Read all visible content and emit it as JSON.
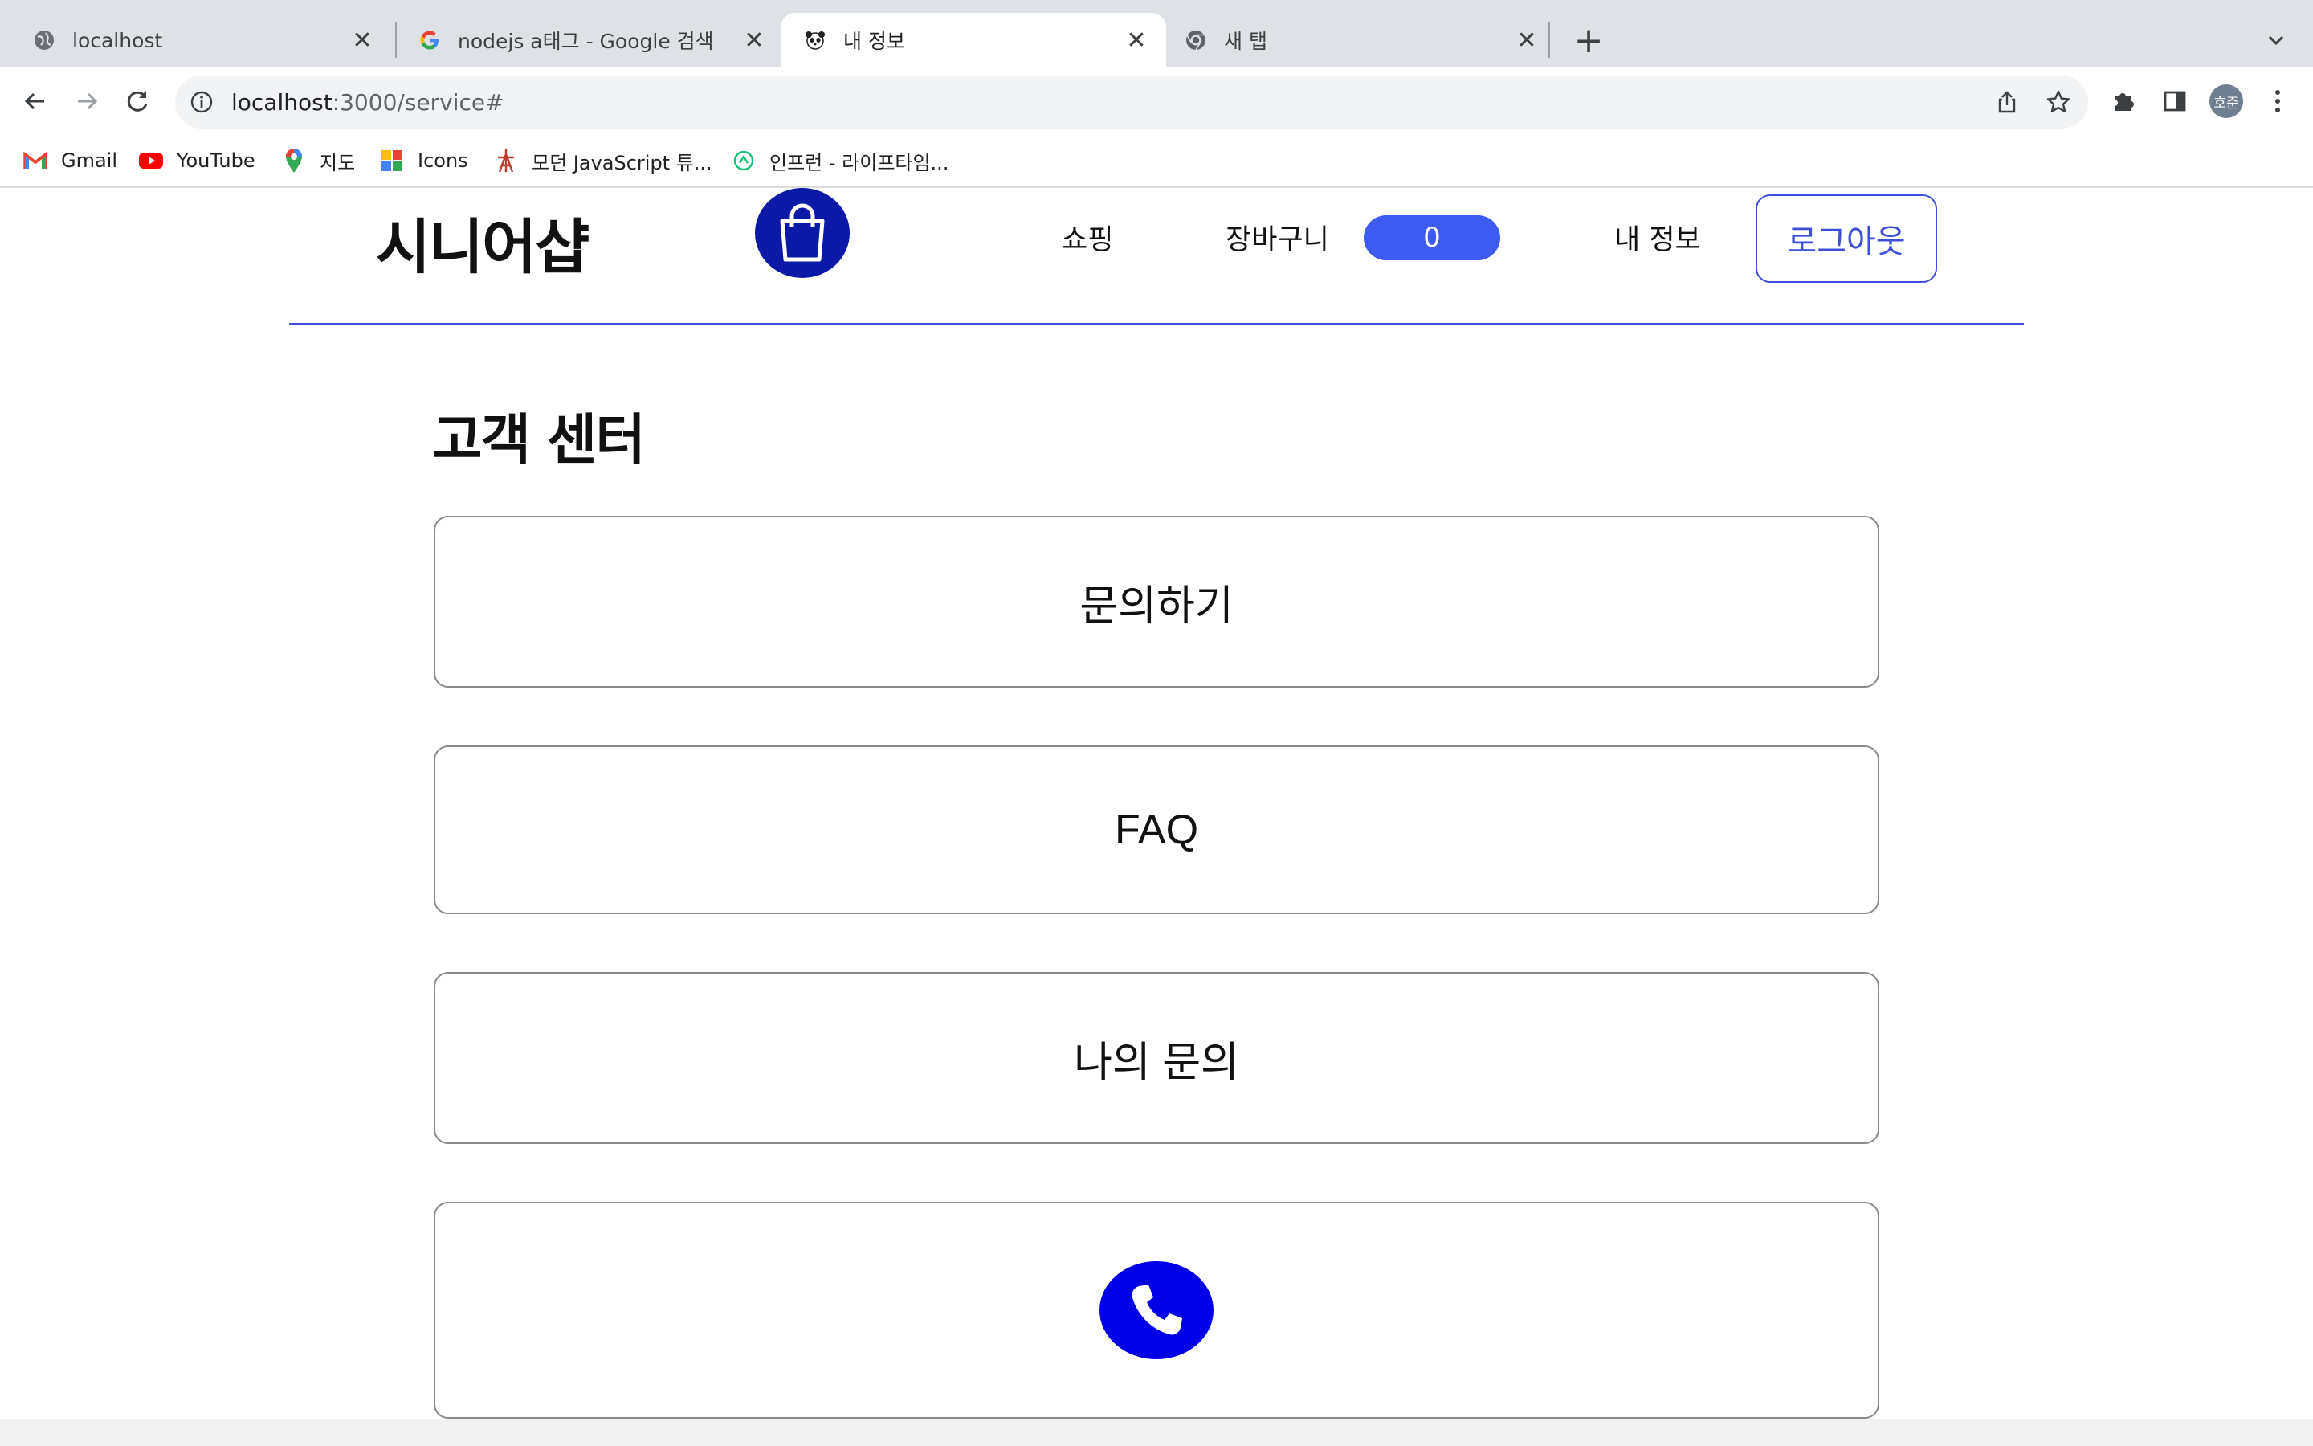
{
  "browser": {
    "tabs": [
      {
        "title": "localhost",
        "icon": "globe-icon",
        "active": false
      },
      {
        "title": "nodejs a태그 - Google 검색",
        "icon": "google-icon",
        "active": false
      },
      {
        "title": "내 정보",
        "icon": "panda-icon",
        "active": true
      },
      {
        "title": "새 탭",
        "icon": "chrome-icon",
        "active": false
      }
    ],
    "close_glyph": "✕",
    "new_tab_glyph": "+",
    "url_host": "localhost",
    "url_rest": ":3000/service#",
    "profile_initials": "호준",
    "bookmarks": [
      {
        "label": "Gmail",
        "icon": "gmail-icon"
      },
      {
        "label": "YouTube",
        "icon": "youtube-icon"
      },
      {
        "label": "지도",
        "icon": "maps-icon"
      },
      {
        "label": "Icons",
        "icon": "icons-icon"
      },
      {
        "label": "모던 JavaScript 튜...",
        "icon": "modern-js-icon"
      },
      {
        "label": "인프런 - 라이프타임...",
        "icon": "inflearn-icon"
      }
    ]
  },
  "site": {
    "logo": "시니어샵",
    "nav": {
      "shopping": "쇼핑",
      "cart": "장바구니",
      "cart_count": "0",
      "my_info": "내 정보",
      "logout": "로그아웃"
    },
    "page_title": "고객 센터",
    "buttons": {
      "inquiry": "문의하기",
      "faq": "FAQ",
      "my_inquiries": "나의 문의"
    },
    "phone_button_icon": "phone-icon"
  },
  "colors": {
    "accent": "#3d5af1",
    "logo_circle": "#0a1aa6",
    "phone_circle": "#0000e6",
    "border": "#8a8a8a"
  }
}
